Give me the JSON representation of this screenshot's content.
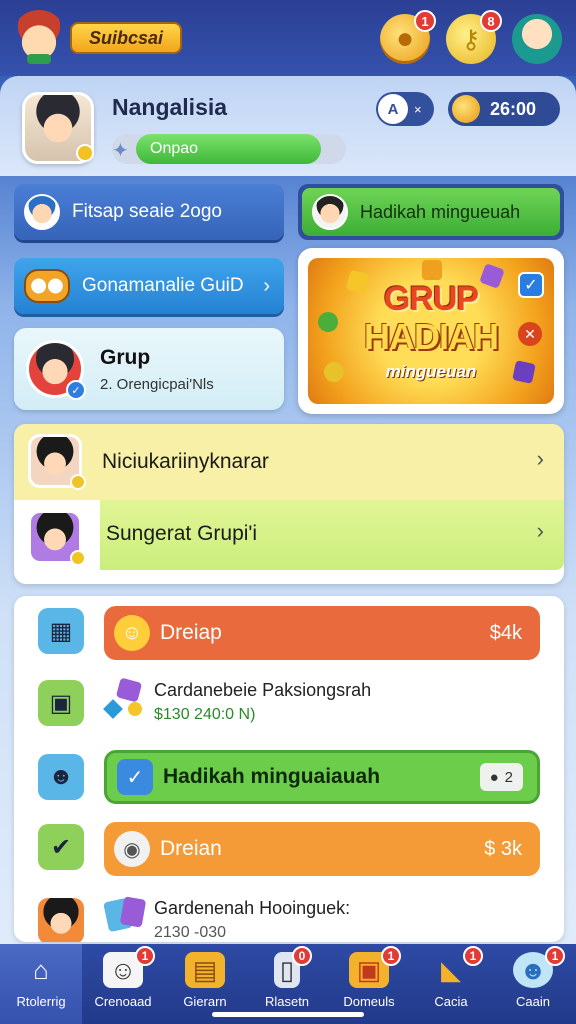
{
  "header": {
    "logo_text": "Suibcsai",
    "icons": [
      {
        "name": "coin-icon",
        "badge": "1"
      },
      {
        "name": "key-icon",
        "badge": "8"
      },
      {
        "name": "person-icon",
        "badge": ""
      }
    ]
  },
  "profile": {
    "name": "Nangalisia",
    "level_label": "Onpao",
    "level_progress": 0.88,
    "pill_letter": "A",
    "pill_suffix": "×",
    "coins": "26:00"
  },
  "actions": {
    "fitsap_label": "Fitsap seaie 2ogo",
    "hadikah_label": "Hadikah mingueuah",
    "gonamanalie_label": "Gonamanalie GuiD",
    "chevron": "›"
  },
  "grup_card": {
    "title": "Grup",
    "subtitle": "2. Orengicpai'Nls"
  },
  "banner": {
    "line1": "GRUP",
    "line2": "HADIAH",
    "line3": "mingueuan"
  },
  "list": {
    "items": [
      {
        "label": "Niciukariinyknarar",
        "chevron": "›"
      },
      {
        "label": "Sungerat Grupi'i",
        "chevron": "›"
      }
    ]
  },
  "feed": {
    "items": [
      {
        "kind": "pill",
        "label": "Dreiap",
        "amount": "$4k",
        "color": "#e86a3d"
      },
      {
        "kind": "text",
        "label": "Cardanebeie Paksiongsrah",
        "sub": "$130 240:0 N)"
      },
      {
        "kind": "pill",
        "label": "Hadikah minguaiauah",
        "badge": "2",
        "color": "#6ccd4a"
      },
      {
        "kind": "pill",
        "label": "Dreian",
        "amount": "$ 3k",
        "color": "#f49a36"
      },
      {
        "kind": "text",
        "label": "Gardenenah Hooinguek:",
        "sub": "2130 -030"
      }
    ]
  },
  "bottom_nav": {
    "items": [
      {
        "label": "Rtolerrig",
        "icon": "home-icon",
        "badge": ""
      },
      {
        "label": "Crenoaad",
        "icon": "cat-icon",
        "badge": "1"
      },
      {
        "label": "Gierarn",
        "icon": "chest-icon",
        "badge": ""
      },
      {
        "label": "Rlasetn",
        "icon": "phone-icon",
        "badge": "0"
      },
      {
        "label": "Domeuls",
        "icon": "box-icon",
        "badge": "1"
      },
      {
        "label": "Cacia",
        "icon": "horn-icon",
        "badge": "1"
      },
      {
        "label": "Caain",
        "icon": "avatar-icon",
        "badge": "1"
      }
    ]
  },
  "colors": {
    "header": "#2b3f94",
    "accent_green": "#3fb83a",
    "accent_blue": "#3564b8",
    "alert": "#e23a34"
  }
}
